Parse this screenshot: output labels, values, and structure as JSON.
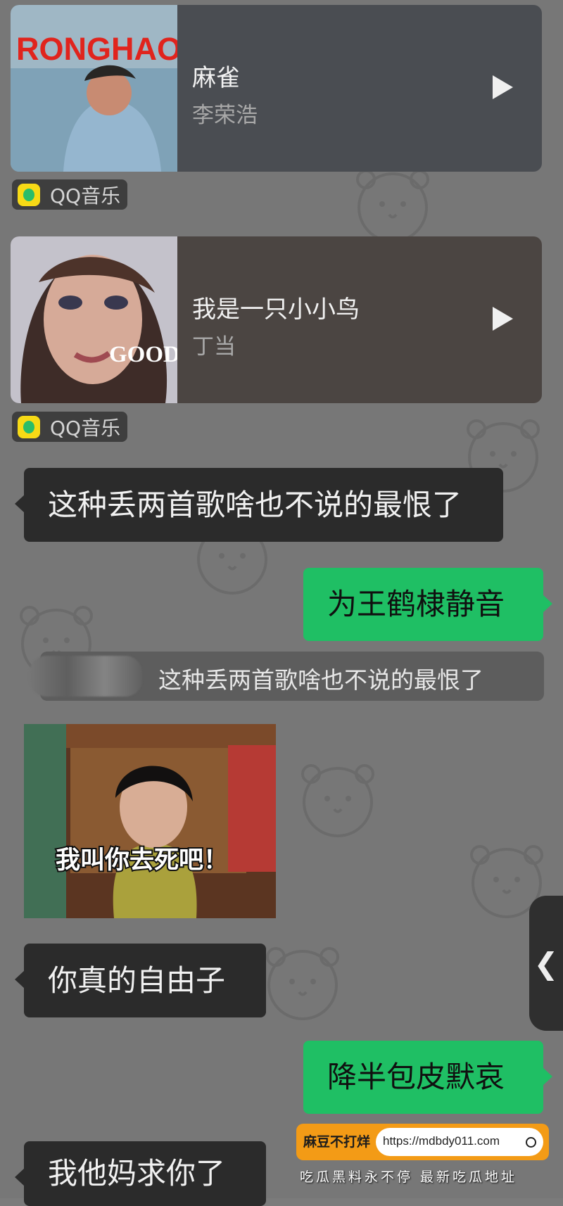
{
  "songs": [
    {
      "cover_text": "RONGHAO",
      "title": "麻雀",
      "artist": "李荣浩",
      "source": "QQ音乐"
    },
    {
      "cover_text": "GOOD",
      "title": "我是一只小小鸟",
      "artist": "丁当",
      "source": "QQ音乐"
    }
  ],
  "messages": [
    {
      "text": "这种丢两首歌啥也不说的最恨了"
    },
    {
      "text": "为王鹤棣静音"
    },
    {
      "quote": "这种丢两首歌啥也不说的最恨了"
    },
    {
      "sticker_caption": "我叫你去死吧！"
    },
    {
      "text": "你真的自由子"
    },
    {
      "text": "降半包皮默哀"
    },
    {
      "text": "我他妈求你了"
    }
  ],
  "side_tab": "❮",
  "footer": {
    "name": "麻豆不打烊",
    "url": "https://mdbdy011.com",
    "caption": "吃瓜黑料永不停 最新吃瓜地址"
  },
  "colors": {
    "background": "#777777",
    "sent_bubble": "#1fbf64",
    "received_bubble": "#2b2b2b",
    "card_1": "#4a4d52",
    "card_2": "#4b4542",
    "footer": "#f39b16"
  }
}
